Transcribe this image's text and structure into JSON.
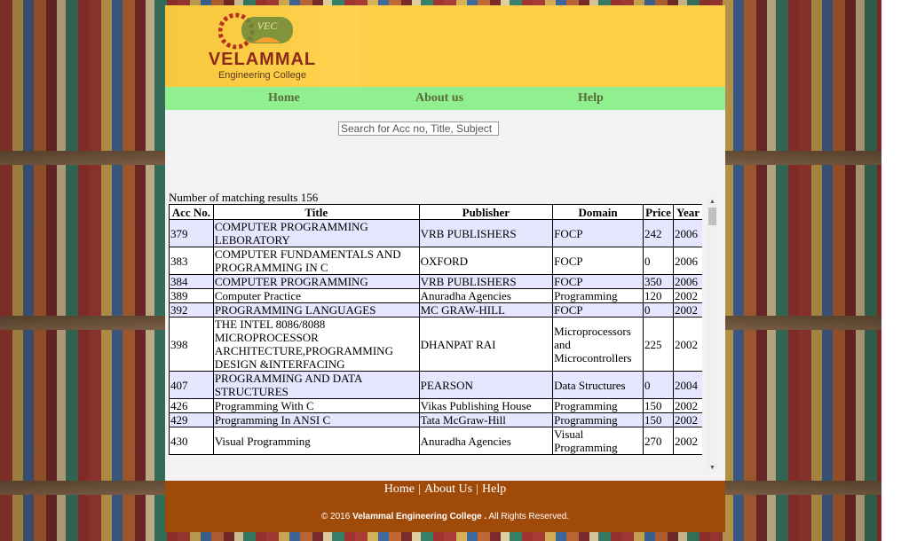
{
  "brand": {
    "name": "VELAMMAL",
    "subtitle": "Engineering College",
    "emblem_text": "VEC"
  },
  "nav": {
    "home": "Home",
    "about": "About us",
    "help": "Help"
  },
  "search": {
    "placeholder": "Search for Acc no, Title, Subject",
    "value": ""
  },
  "results": {
    "count_label": "Number of matching results 156",
    "columns": [
      "Acc No.",
      "Title",
      "Publisher",
      "Domain",
      "Price",
      "Year"
    ],
    "rows": [
      {
        "acc": "379",
        "title": "COMPUTER PROGRAMMING LEBORATORY",
        "publisher": "VRB PUBLISHERS",
        "domain": "FOCP",
        "price": "242",
        "year": "2006"
      },
      {
        "acc": "383",
        "title": "COMPUTER FUNDAMENTALS AND PROGRAMMING IN C",
        "publisher": "OXFORD",
        "domain": "FOCP",
        "price": "0",
        "year": "2006"
      },
      {
        "acc": "384",
        "title": "COMPUTER PROGRAMMING",
        "publisher": "VRB PUBLISHERS",
        "domain": "FOCP",
        "price": "350",
        "year": "2006"
      },
      {
        "acc": "389",
        "title": "Computer Practice",
        "publisher": "Anuradha Agencies",
        "domain": "Programming",
        "price": "120",
        "year": "2002"
      },
      {
        "acc": "392",
        "title": "PROGRAMMING LANGUAGES",
        "publisher": "MC GRAW-HILL",
        "domain": "FOCP",
        "price": "0",
        "year": "2002"
      },
      {
        "acc": "398",
        "title": "THE INTEL 8086/8088 MICROPROCESSOR ARCHITECTURE,PROGRAMMING DESIGN &INTERFACING",
        "publisher": "DHANPAT RAI",
        "domain": "Microprocessors and Microcontrollers",
        "price": "225",
        "year": "2002"
      },
      {
        "acc": "407",
        "title": "PROGRAMMING AND DATA STRUCTURES",
        "publisher": "PEARSON",
        "domain": "Data Structures",
        "price": "0",
        "year": "2004"
      },
      {
        "acc": "426",
        "title": "Programming With C",
        "publisher": "Vikas Publishing House",
        "domain": "Programming",
        "price": "150",
        "year": "2002"
      },
      {
        "acc": "429",
        "title": "Programming In ANSI C",
        "publisher": "Tata McGraw-Hill",
        "domain": "Programming",
        "price": "150",
        "year": "2002"
      },
      {
        "acc": "430",
        "title": "Visual Programming",
        "publisher": "Anuradha Agencies",
        "domain": "Visual Programming",
        "price": "270",
        "year": "2002"
      }
    ]
  },
  "footer": {
    "links": [
      "Home",
      "About Us",
      "Help"
    ],
    "copyright_prefix": "© 2016",
    "copyright_name": "Velammal Engineering College .",
    "copyright_suffix": "All Rights Reserved."
  }
}
